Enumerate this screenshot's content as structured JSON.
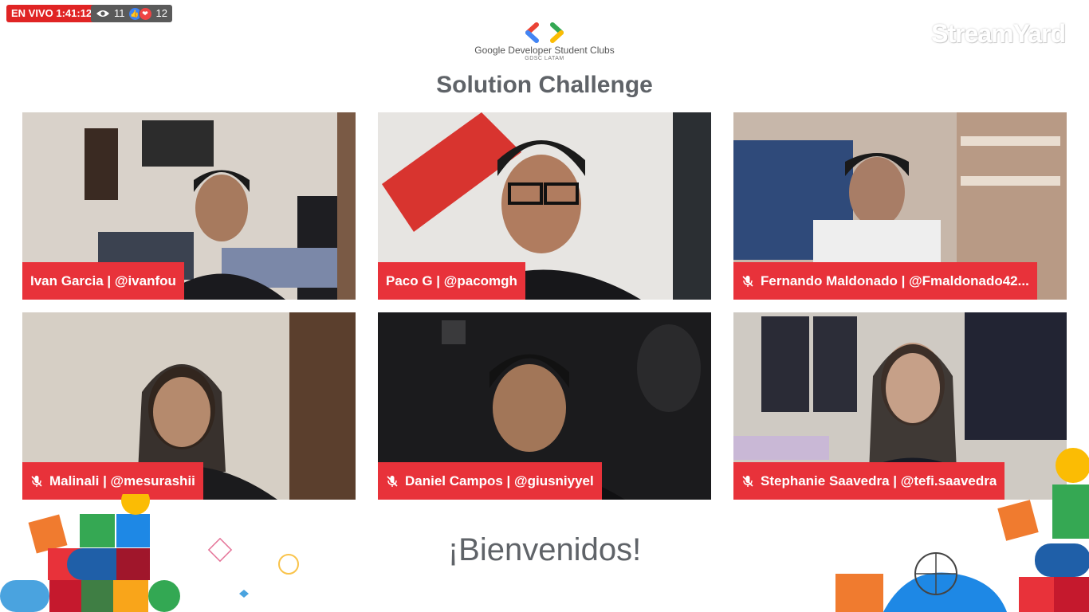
{
  "status": {
    "live_label": "EN VIVO 1:41:12",
    "viewers": "11",
    "reactions": "12"
  },
  "brand": {
    "watermark": "StreamYard",
    "org_name": "Google Developer Student Clubs",
    "org_sub": "GDSC LATAM",
    "title": "Solution Challenge"
  },
  "participants": [
    {
      "label": "Ivan Garcia | @ivanfou",
      "muted": false
    },
    {
      "label": "Paco G | @pacomgh",
      "muted": false
    },
    {
      "label": "Fernando Maldonado | @Fmaldonado42...",
      "muted": true
    },
    {
      "label": "Malinali | @mesurashii",
      "muted": true
    },
    {
      "label": "Daniel Campos | @giusniyyel",
      "muted": true
    },
    {
      "label": "Stephanie Saavedra | @tefi.saavedra",
      "muted": true
    }
  ],
  "footer": {
    "welcome": "¡Bienvenidos!"
  },
  "icons": [
    "eye-icon",
    "like-icon",
    "heart-icon",
    "mic-muted-icon",
    "gdsc-logo-icon"
  ],
  "colors": {
    "live_red": "#e02424",
    "nameplate_red": "#e8323a",
    "title_gray": "#5f6368"
  }
}
